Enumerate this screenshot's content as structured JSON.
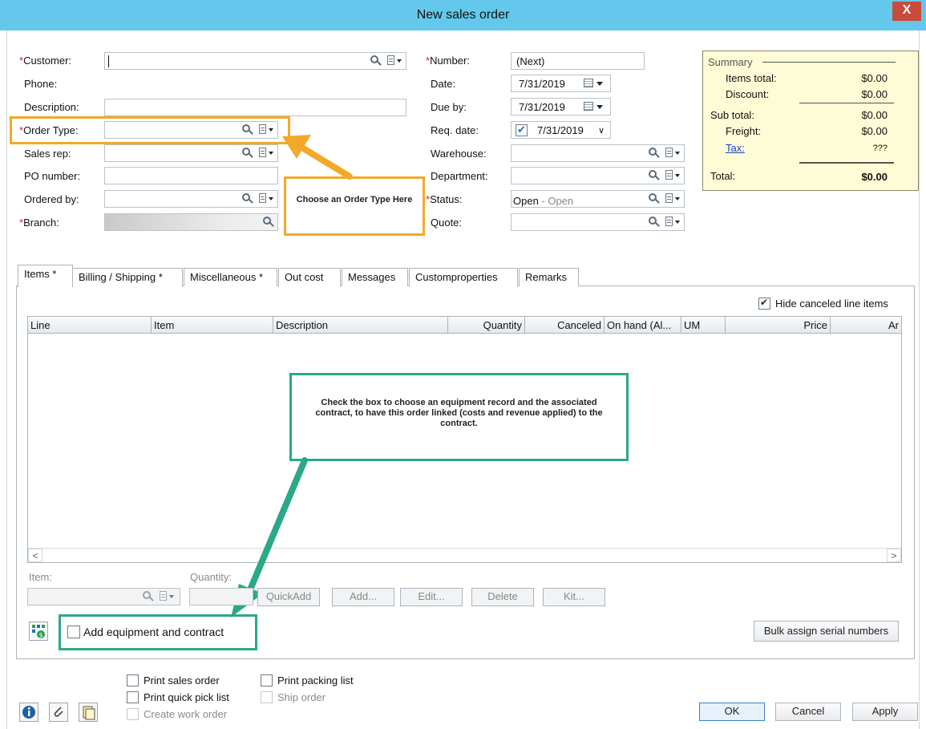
{
  "window": {
    "title": "New sales order",
    "close_glyph": "X"
  },
  "left_form": {
    "customer": {
      "label": "Customer:",
      "value": ""
    },
    "phone": {
      "label": "Phone:"
    },
    "description": {
      "label": "Description:",
      "value": ""
    },
    "order_type": {
      "label": "Order Type:",
      "value": ""
    },
    "sales_rep": {
      "label": "Sales rep:",
      "value": ""
    },
    "po_number": {
      "label": "PO number:",
      "value": ""
    },
    "ordered_by": {
      "label": "Ordered by:",
      "value": ""
    },
    "branch": {
      "label": "Branch:",
      "value": ""
    }
  },
  "mid_form": {
    "number": {
      "label": "Number:",
      "value": "(Next)"
    },
    "date": {
      "label": "Date:",
      "value": "7/31/2019"
    },
    "due_by": {
      "label": "Due by:",
      "value": "7/31/2019"
    },
    "req_date": {
      "label": "Req. date:",
      "value": "7/31/2019",
      "checked": true
    },
    "warehouse": {
      "label": "Warehouse:",
      "value": ""
    },
    "department": {
      "label": "Department:",
      "value": ""
    },
    "status": {
      "label": "Status:",
      "value": "Open",
      "sub": " - Open"
    },
    "quote": {
      "label": "Quote:",
      "value": ""
    }
  },
  "summary": {
    "title": "Summary",
    "items_total": {
      "label": "Items total:",
      "value": "$0.00"
    },
    "discount": {
      "label": "Discount:",
      "value": "$0.00"
    },
    "sub_total": {
      "label": "Sub total:",
      "value": "$0.00"
    },
    "freight": {
      "label": "Freight:",
      "value": "$0.00"
    },
    "tax": {
      "label": "Tax:",
      "value": "???"
    },
    "total": {
      "label": "Total:",
      "value": "$0.00"
    }
  },
  "callouts": {
    "order_type": "Choose an Order Type Here",
    "equipment": "Check the box to choose an equipment record and the associated contract, to have this order linked (costs and revenue applied) to the contract."
  },
  "tabs": [
    {
      "label": "Items *"
    },
    {
      "label": "Billing / Shipping  *"
    },
    {
      "label": "Miscellaneous *"
    },
    {
      "label": "Out cost"
    },
    {
      "label": "Messages"
    },
    {
      "label": "Customproperties"
    },
    {
      "label": "Remarks"
    }
  ],
  "items_tab": {
    "hide_canceled": {
      "label": "Hide canceled line items",
      "checked": true
    },
    "columns": [
      "Line",
      "Item",
      "Description",
      "Quantity",
      "Canceled",
      "On hand (Al...",
      "UM",
      "Price",
      "Ar"
    ],
    "item_label": "Item:",
    "quantity_label": "Quantity:",
    "buttons": {
      "quickadd": "QuickAdd",
      "add": "Add...",
      "edit": "Edit...",
      "delete": "Delete",
      "kit": "Kit..."
    },
    "add_equipment": {
      "label": "Add equipment and contract",
      "checked": false
    },
    "bulk_assign": "Bulk assign serial numbers"
  },
  "footer": {
    "print_sales_order": "Print sales order",
    "print_quick_pick": "Print quick pick list",
    "create_work_order": "Create work order",
    "print_packing_list": "Print packing list",
    "ship_order": "Ship order",
    "ok": "OK",
    "cancel": "Cancel",
    "apply": "Apply"
  },
  "colors": {
    "titlebar": "#63c8ec",
    "close": "#c84b3c",
    "callout_orange": "#f2a92a",
    "callout_green": "#2aa889",
    "summary_bg": "#fdfcd6",
    "link": "#1a3fc9"
  }
}
